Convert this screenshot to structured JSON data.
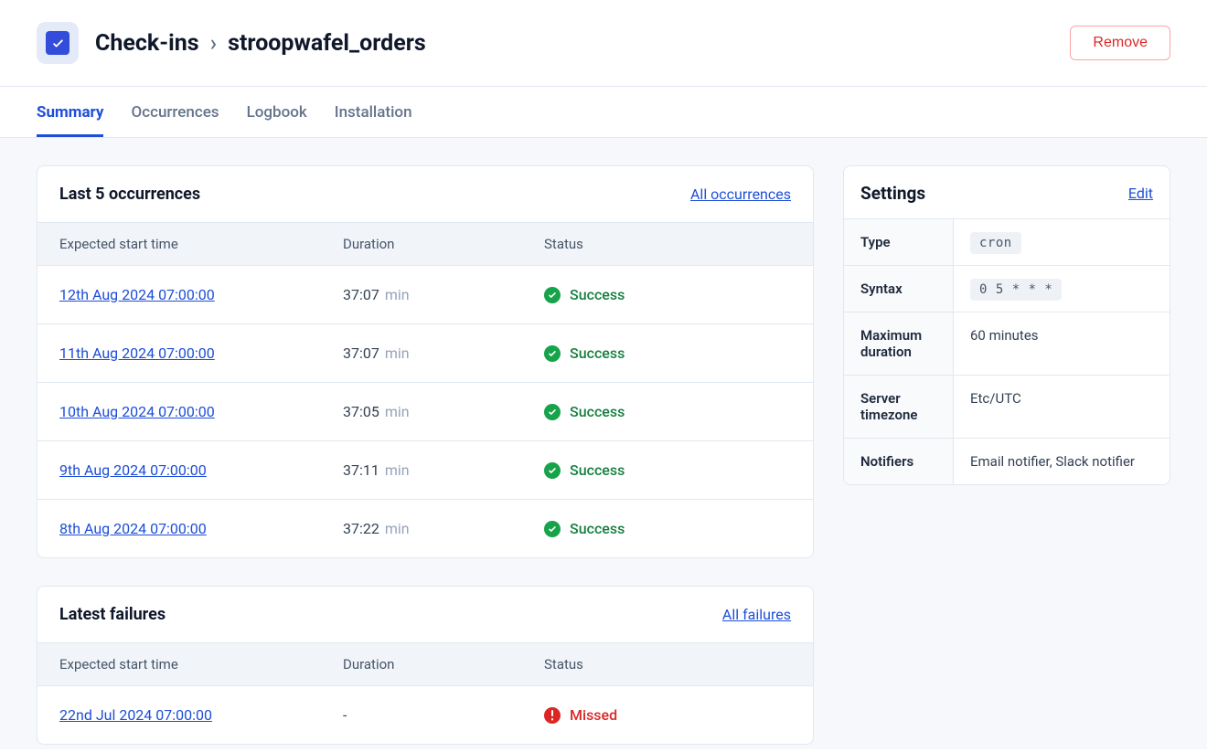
{
  "header": {
    "breadcrumb_root": "Check-ins",
    "breadcrumb_current": "stroopwafel_orders",
    "remove_button": "Remove"
  },
  "tabs": {
    "summary": "Summary",
    "occurrences": "Occurrences",
    "logbook": "Logbook",
    "installation": "Installation"
  },
  "occurrences_card": {
    "title": "Last 5 occurrences",
    "all_link": "All occurrences",
    "columns": {
      "time": "Expected start time",
      "duration": "Duration",
      "status": "Status"
    },
    "duration_unit": "min",
    "status_success": "Success",
    "rows": [
      {
        "time": "12th Aug 2024 07:00:00",
        "duration": "37:07"
      },
      {
        "time": "11th Aug 2024 07:00:00",
        "duration": "37:07"
      },
      {
        "time": "10th Aug 2024 07:00:00",
        "duration": "37:05"
      },
      {
        "time": "9th Aug 2024 07:00:00",
        "duration": "37:11"
      },
      {
        "time": "8th Aug 2024 07:00:00",
        "duration": "37:22"
      }
    ]
  },
  "failures_card": {
    "title": "Latest failures",
    "all_link": "All failures",
    "columns": {
      "time": "Expected start time",
      "duration": "Duration",
      "status": "Status"
    },
    "status_missed": "Missed",
    "row": {
      "time": "22nd Jul 2024 07:00:00",
      "duration": "-"
    }
  },
  "settings_card": {
    "title": "Settings",
    "edit_link": "Edit",
    "labels": {
      "type": "Type",
      "syntax": "Syntax",
      "max_duration": "Maximum duration",
      "timezone": "Server timezone",
      "notifiers": "Notifiers"
    },
    "values": {
      "type": "cron",
      "syntax": "0 5 * * *",
      "max_duration": "60 minutes",
      "timezone": "Etc/UTC",
      "notifiers": "Email notifier, Slack notifier"
    }
  }
}
